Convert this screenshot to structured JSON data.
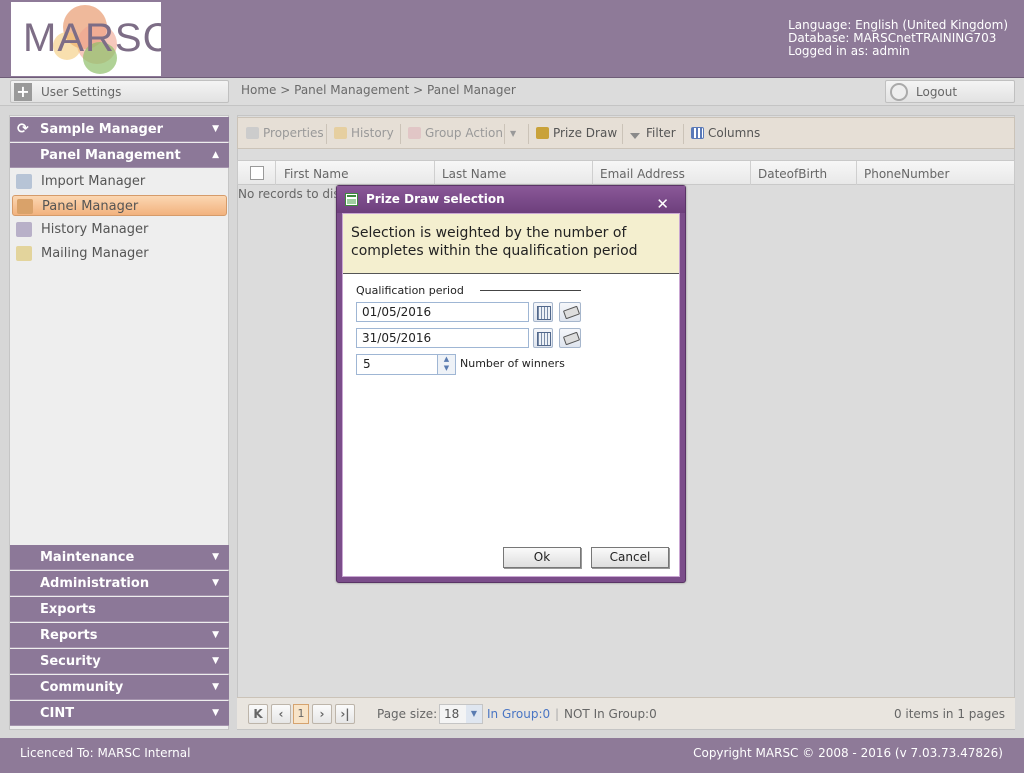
{
  "header": {
    "logo_text": "MARSC",
    "language": "Language: English (United Kingdom)",
    "database": "Database: MARSCnetTRAINING703",
    "logged_in": "Logged in as: admin"
  },
  "topbar": {
    "user_settings": "User Settings",
    "breadcrumb": "Home > Panel Management > Panel Manager",
    "logout": "Logout"
  },
  "sidebar": {
    "sample_manager": "Sample Manager",
    "panel_management": "Panel Management",
    "items": [
      {
        "label": "Import Manager",
        "icon": "import-icon"
      },
      {
        "label": "Panel Manager",
        "icon": "panel-icon",
        "selected": true
      },
      {
        "label": "History Manager",
        "icon": "history-icon"
      },
      {
        "label": "Mailing Manager",
        "icon": "mailing-icon"
      }
    ],
    "bottom_sections": [
      "Maintenance",
      "Administration",
      "Exports",
      "Reports",
      "Security",
      "Community",
      "CINT"
    ]
  },
  "toolbar": {
    "properties": "Properties",
    "history": "History",
    "group_action": "Group Action",
    "prize_draw": "Prize Draw",
    "filter": "Filter",
    "columns": "Columns"
  },
  "grid": {
    "columns": [
      "First Name",
      "Last Name",
      "Email Address",
      "DateofBirth",
      "PhoneNumber"
    ],
    "empty_text": "No records to display."
  },
  "pager": {
    "current_page": "1",
    "page_size_label": "Page size:",
    "page_size": "18",
    "in_group": "In Group:0",
    "not_in_group": "NOT In Group:0",
    "items_info": "0 items in 1 pages"
  },
  "footer": {
    "licence": "Licenced To: MARSC Internal",
    "copyright": "Copyright MARSC © 2008 - 2016  (v 7.03.73.47826)"
  },
  "dialog": {
    "title": "Prize Draw selection",
    "message": "Selection is weighted by the number of completes within the qualification period",
    "qualification_label": "Qualification period",
    "date_from": "01/05/2016",
    "date_to": "31/05/2016",
    "winners_value": "5",
    "winners_label": "Number of winners",
    "ok": "Ok",
    "cancel": "Cancel"
  },
  "colors": {
    "brand_purple": "#8e7a98",
    "dialog_purple": "#7b4d8a",
    "selected_item": "#f2b27e"
  }
}
